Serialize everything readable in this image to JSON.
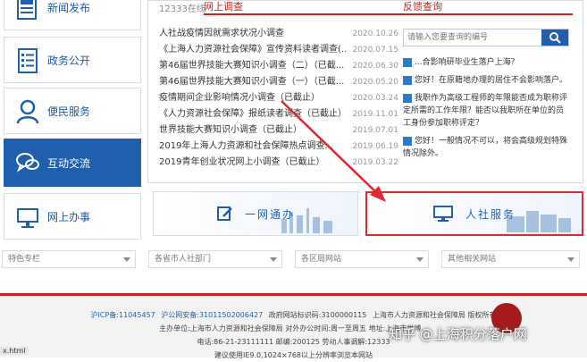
{
  "sidebar": {
    "items": [
      {
        "label": "新闻发布",
        "icon": "newspaper-icon",
        "active": false
      },
      {
        "label": "政务公开",
        "icon": "document-list-icon",
        "active": false
      },
      {
        "label": "便民服务",
        "icon": "user-icon",
        "active": false
      },
      {
        "label": "互动交流",
        "icon": "chat-bubbles-icon",
        "active": true
      },
      {
        "label": "网上办事",
        "icon": "monitor-icon",
        "active": false
      }
    ]
  },
  "center": {
    "tabs": {
      "hotline": "12333在线",
      "survey": "网上调查"
    },
    "news": [
      {
        "title": "人社战疫情因就需求状况小调查",
        "date": "2020.10.26"
      },
      {
        "title": "《上海人力资源社会保障》宣传资料读者调查(...",
        "date": "2020.07.15"
      },
      {
        "title": "第46届世界技能大赛知识小调查（二）（已截...",
        "date": "2020.06.30"
      },
      {
        "title": "第46届世界技能大赛知识小调查（一）（已截...",
        "date": "2020.05.20"
      },
      {
        "title": "疫情期间企业影响情况小调查（已截止）",
        "date": "2020.03.24"
      },
      {
        "title": "《人力资源社会保障》报纸读者调查（已截止）",
        "date": "2019.11.01"
      },
      {
        "title": "世界技能大赛知识小调查（已截止）",
        "date": "2019.07.01"
      },
      {
        "title": "2019年上海人力资源和社会保障热点调查...",
        "date": "2019.06.19"
      },
      {
        "title": "2019青年创业状况网上小调查（已截止）",
        "date": "2019.03.22"
      }
    ]
  },
  "results": {
    "title": "反馈查询",
    "search": {
      "placeholder": "请输入您要查询的编号",
      "icon": "search-icon"
    },
    "qa": [
      {
        "text": "...合影响研毕业生落户上海？"
      },
      {
        "text": "您好！在原籍地办理的居住不会影响落户。"
      },
      {
        "text": "我职作为高级工程师的年限能否成为职称评定所需的工作年限？能否以我职所在单位的员工身份参加职称评定？"
      },
      {
        "text": "您好！一般情况不可以，将会高级规划特殊情况除外。"
      }
    ]
  },
  "banners": {
    "left": "一网通办",
    "right": "人社服务"
  },
  "selects": [
    {
      "label": "特色专栏"
    },
    {
      "label": "各省市人社部门"
    },
    {
      "label": "各区局网站"
    },
    {
      "label": "其他相关网站"
    }
  ],
  "footer": {
    "icp": "沪ICP备:11045457",
    "police": "沪公网安备:31011502006427",
    "site_code": "政府网站标识码:3100000115",
    "copyright": "上海市人力资源和社会保障局 版权所有",
    "line2": "主办单位:上海市人力资源和社会保障局 对外办公时间:周一至周五 地址:上海市世博...",
    "line3": "电话:86-21-23111111 邮编:200125 劳动人事调解:12333",
    "line4": "建议使用IE9.0,1024×768以上分辨率浏览本网站"
  },
  "watermark": "知乎 @上海积分落户网",
  "file_label": "x.html",
  "colors": {
    "brand_blue": "#1f5fae",
    "accent_red": "#c9211b",
    "highlight": "#e0282d"
  }
}
